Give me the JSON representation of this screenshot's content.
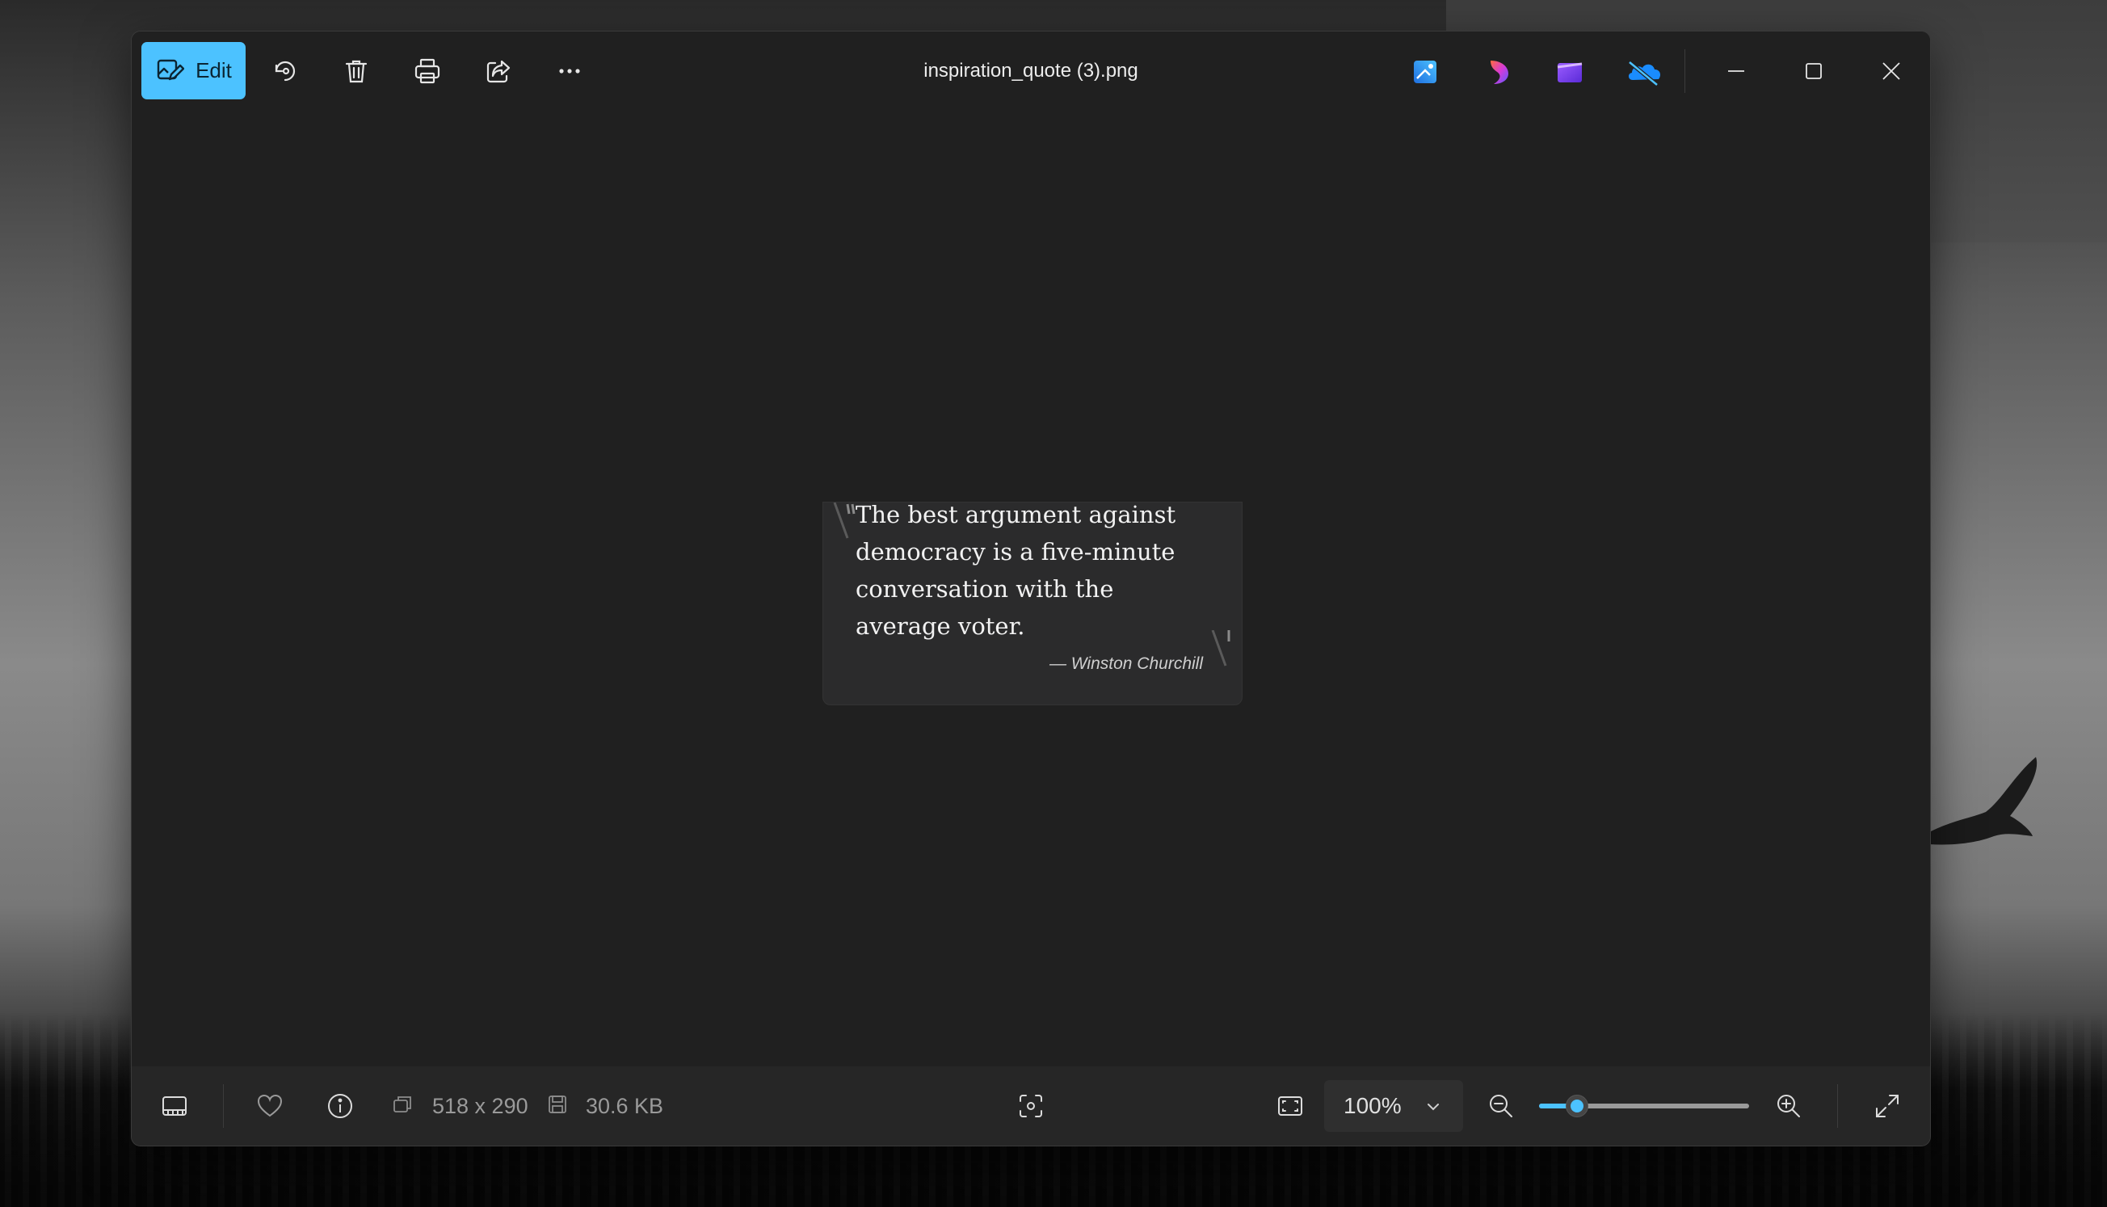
{
  "window": {
    "title": "inspiration_quote (3).png"
  },
  "toolbar": {
    "edit_label": "Edit",
    "icons": [
      "edit-image-icon",
      "rotate-icon",
      "delete-icon",
      "print-icon",
      "share-icon",
      "more-icon"
    ]
  },
  "app_icons": [
    "image-creator-app-icon",
    "copilot-app-icon",
    "clipchamp-app-icon",
    "onedrive-app-icon"
  ],
  "window_controls": [
    "minimize-icon",
    "maximize-icon",
    "close-icon"
  ],
  "image": {
    "quote": "The best argument against democracy is a five-minute conversation with the average voter.",
    "author": "— Winston Churchill"
  },
  "bottombar": {
    "dimensions": "518 x 290",
    "file_size": "30.6 KB",
    "zoom": "100%",
    "zoom_slider_fraction": 0.18
  },
  "colors": {
    "accent": "#4cc2ff",
    "window_bg": "#202020",
    "bar_bg": "#262626"
  }
}
